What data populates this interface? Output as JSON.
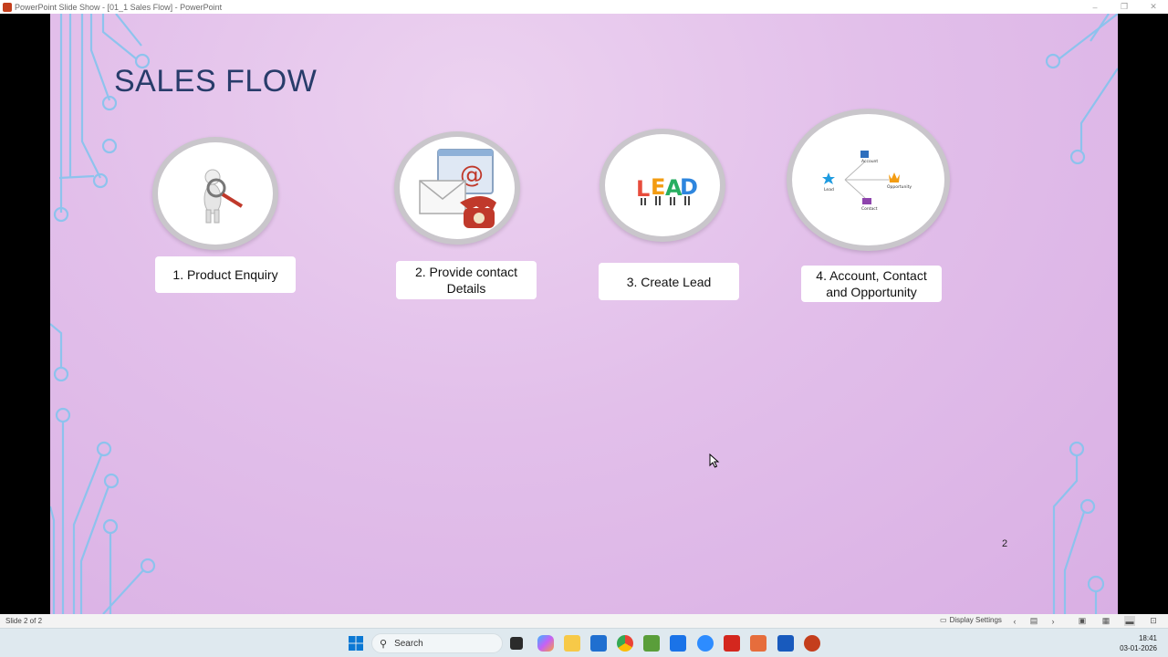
{
  "window": {
    "title": "PowerPoint Slide Show - [01_1 Sales Flow] - PowerPoint",
    "controls": [
      "–",
      "❐",
      "✕"
    ]
  },
  "slide": {
    "title": "SALES FLOW",
    "steps": [
      {
        "label": "1. Product Enquiry",
        "icon": "magnifier-person-icon"
      },
      {
        "label": "2. Provide contact Details",
        "icon": "mail-phone-icon"
      },
      {
        "label": "3. Create Lead",
        "icon": "lead-letters-icon"
      },
      {
        "label": "4. Account, Contact and Opportunity",
        "icon": "crm-diagram-icon",
        "diagram_labels": {
          "lead": "Lead",
          "account": "Account",
          "opportunity": "Opportunity",
          "contact": "Contact"
        }
      }
    ],
    "lead_letters": [
      "L",
      "E",
      "A",
      "D"
    ],
    "number": "2",
    "background_color": "#e2bfea",
    "title_color": "#283c6a",
    "deco_color": "#7ec8f0"
  },
  "statusbar": {
    "slide_count": "Slide 2 of 2",
    "display_settings": "Display Settings"
  },
  "taskbar": {
    "search_placeholder": "Search",
    "time": "18:41",
    "date": "03-01-2026"
  }
}
